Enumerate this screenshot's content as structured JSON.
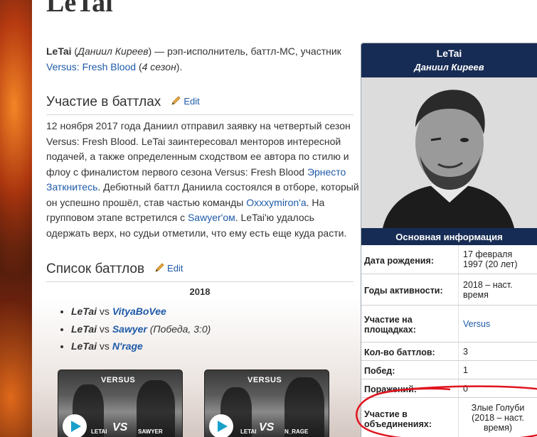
{
  "article": {
    "title": "LeTai",
    "lead": {
      "name": "LeTai",
      "real_name": "Даниил Киреев",
      "desc": " — рэп-исполнитель, баттл-MC, участник ",
      "link": "Versus: Fresh Blood",
      "season": "4 сезон"
    },
    "section1": {
      "heading": "Участие в баттлах",
      "edit": "Edit",
      "text_a": "12 ноября 2017 года Даниил отправил заявку на четвертый сезон Versus: Fresh Blood. LeTai заинтересовал менторов интересной подачей, а также определенным сходством ее автора по стилю и флоу с финалистом первого сезона Versus: Fresh Blood ",
      "link_a": "Эрнесто Заткнитесь",
      "text_b": ". Дебютный баттл Даниила состоялся в отборе, который он успешно прошёл, став частью команды ",
      "link_b": "Oxxxymiron'а",
      "text_c": ". На групповом этапе встретился с ",
      "link_c": "Sawyer'ом",
      "text_d": ". LeTai'ю удалось одержать верх, но судьи отметили, что ему есть еще куда расти."
    },
    "section2": {
      "heading": "Список баттлов",
      "edit": "Edit",
      "year": "2018",
      "battles": [
        {
          "p1": "LeTai",
          "vs": " vs ",
          "p2": "VityaBoVee",
          "note": ""
        },
        {
          "p1": "LeTai",
          "vs": " vs ",
          "p2": "Sawyer",
          "note": " (Победа, 3:0)"
        },
        {
          "p1": "LeTai",
          "vs": " vs ",
          "p2": "N'rage",
          "note": ""
        }
      ]
    },
    "videos": [
      {
        "logo": "VERSUS",
        "left": "LETAI",
        "right": "SAWYER",
        "vs": "VS"
      },
      {
        "logo": "VERSUS",
        "left": "LETAI",
        "right": "N_RAGE",
        "vs": "VS"
      }
    ]
  },
  "infobox": {
    "name": "LeTai",
    "real_name": "Даниил Киреев",
    "section": "Основная информация",
    "rows": [
      {
        "key": "Дата рождения:",
        "value": "17 февраля 1997 (20 лет)"
      },
      {
        "key": "Годы активности:",
        "value": "2018 – наст. время"
      },
      {
        "key": "Участие на площадках:",
        "value": "Versus"
      },
      {
        "key": "Кол-во баттлов:",
        "value": "3"
      },
      {
        "key": "Побед:",
        "value": "1"
      },
      {
        "key": "Поражений:",
        "value": "0"
      },
      {
        "key": "Участие в объединениях:",
        "value": "Злые Голуби (2018 – наст. время)"
      }
    ]
  },
  "colors": {
    "link": "#1e5aa8",
    "infobox_header": "#172c54",
    "annotation": "#e0141e"
  }
}
